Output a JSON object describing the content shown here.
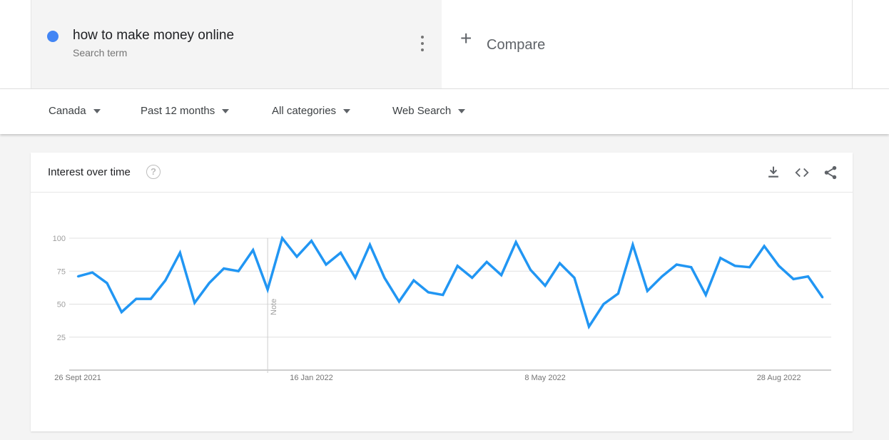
{
  "search_term": {
    "label": "how to make money online",
    "sublabel": "Search term",
    "dot_color": "#4285f4"
  },
  "compare": {
    "plus": "+",
    "label": "Compare"
  },
  "filters": [
    {
      "label": "Canada"
    },
    {
      "label": "Past 12 months"
    },
    {
      "label": "All categories"
    },
    {
      "label": "Web Search"
    }
  ],
  "widget": {
    "title": "Interest over time",
    "help": "?",
    "icons": [
      "download-icon",
      "embed-icon",
      "share-icon"
    ]
  },
  "chart_data": {
    "type": "line",
    "ylim": [
      0,
      100
    ],
    "yticks": [
      25,
      50,
      75,
      100
    ],
    "xtick_labels": [
      "26 Sept 2021",
      "16 Jan 2022",
      "8 May 2022",
      "28 Aug 2022"
    ],
    "xtick_indices": [
      0,
      16,
      32,
      48
    ],
    "note_label": "Note",
    "note_index": 13,
    "grid": true,
    "line_color": "#2196f3",
    "series": [
      {
        "values": [
          71,
          74,
          66,
          44,
          54,
          54,
          68,
          89,
          51,
          66,
          77,
          75,
          91,
          61,
          100,
          86,
          98,
          80,
          89,
          70,
          95,
          70,
          52,
          68,
          59,
          57,
          79,
          70,
          82,
          72,
          97,
          76,
          64,
          81,
          70,
          33,
          50,
          58,
          95,
          60,
          71,
          80,
          78,
          57,
          85,
          79,
          78,
          94,
          79,
          69,
          71,
          55
        ]
      }
    ]
  }
}
